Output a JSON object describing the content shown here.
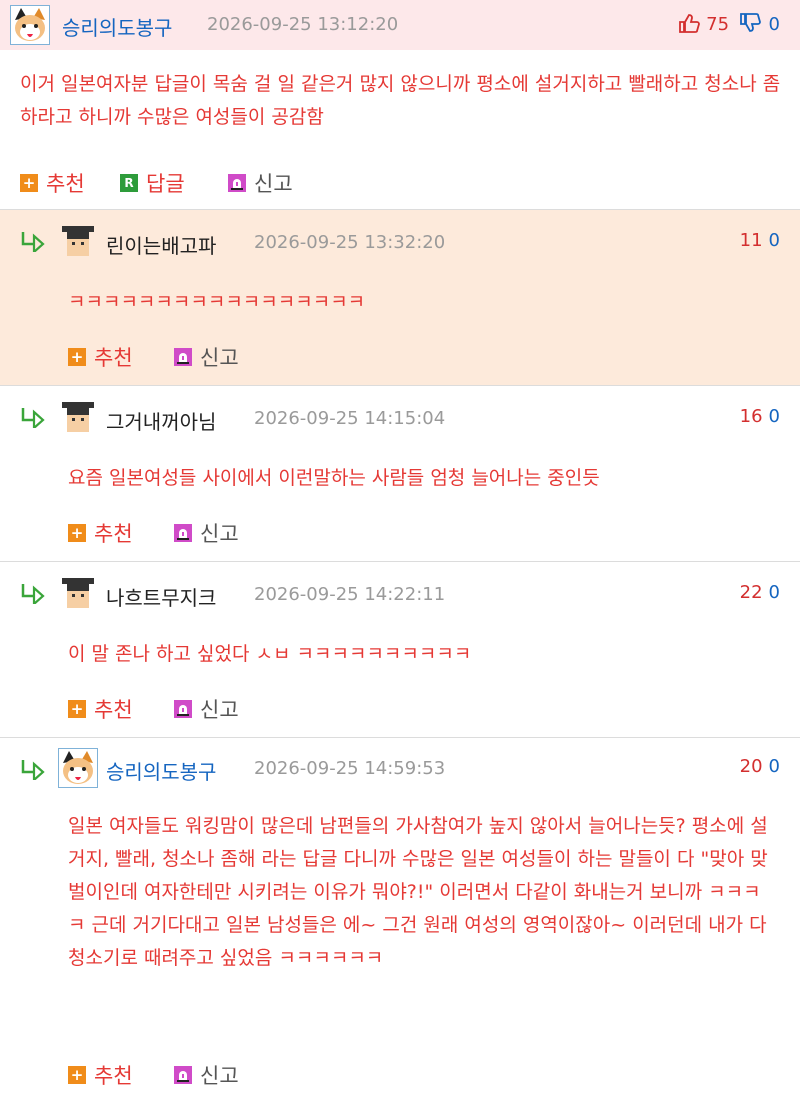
{
  "root_comment": {
    "nickname": "승리의도봉구",
    "datetime": "2026-09-25 13:12:20",
    "up_count": "75",
    "down_count": "0",
    "body": "이거 일본여자분 답글이 목숨 걸 일 같은거 많지 않으니까 평소에 설거지하고 빨래하고 청소나 좀 하라고 하니까 수많은 여성들이 공감함",
    "actions": {
      "recommend": "추천",
      "reply": "답글",
      "report": "신고"
    }
  },
  "replies": [
    {
      "nickname": "린이는배고파",
      "datetime": "2026-09-25 13:32:20",
      "up_count": "11",
      "down_count": "0",
      "body": "ㅋㅋㅋㅋㅋㅋㅋㅋㅋㅋㅋㅋㅋㅋㅋㅋㅋ",
      "recommend": "추천",
      "report": "신고"
    },
    {
      "nickname": "그거내꺼아님",
      "datetime": "2026-09-25 14:15:04",
      "up_count": "16",
      "down_count": "0",
      "body": "요즘 일본여성들 사이에서 이런말하는 사람들 엄청 늘어나는 중인듯",
      "recommend": "추천",
      "report": "신고"
    },
    {
      "nickname": "나흐트무지크",
      "datetime": "2026-09-25 14:22:11",
      "up_count": "22",
      "down_count": "0",
      "body": "이 말 존나 하고 싶었다 ㅅㅂ ㅋㅋㅋㅋㅋㅋㅋㅋㅋㅋ",
      "recommend": "추천",
      "report": "신고"
    },
    {
      "nickname": "승리의도봉구",
      "datetime": "2026-09-25 14:59:53",
      "up_count": "20",
      "down_count": "0",
      "body": "일본 여자들도 워킹맘이 많은데 남편들의 가사참여가 높지 않아서 늘어나는듯? 평소에 설거지, 빨래, 청소나 좀해 라는 답글 다니까 수많은 일본 여성들이 하는 말들이 다 \"맞아 맞벌이인데 여자한테만 시키려는 이유가 뭐야?!\" 이러면서 다같이 화내는거 보니까 ㅋㅋㅋㅋ 근데 거기다대고 일본 남성들은 에~ 그건 원래 여성의 영역이잖아~ 이러던데 내가 다 청소기로 때려주고 싶었음 ㅋㅋㅋㅋㅋㅋ",
      "recommend": "추천",
      "report": "신고"
    }
  ],
  "colors": {
    "root_header_bg": "#fde8ea",
    "highlight_bg": "#fdeadb",
    "text_red": "#e53935",
    "nick_blue": "#1565c0"
  },
  "icons": [
    "cat-avatar",
    "graduate-avatar",
    "reply-arrow-icon",
    "thumb-up-icon",
    "thumb-down-icon",
    "plus-icon",
    "r-icon",
    "siren-icon"
  ]
}
